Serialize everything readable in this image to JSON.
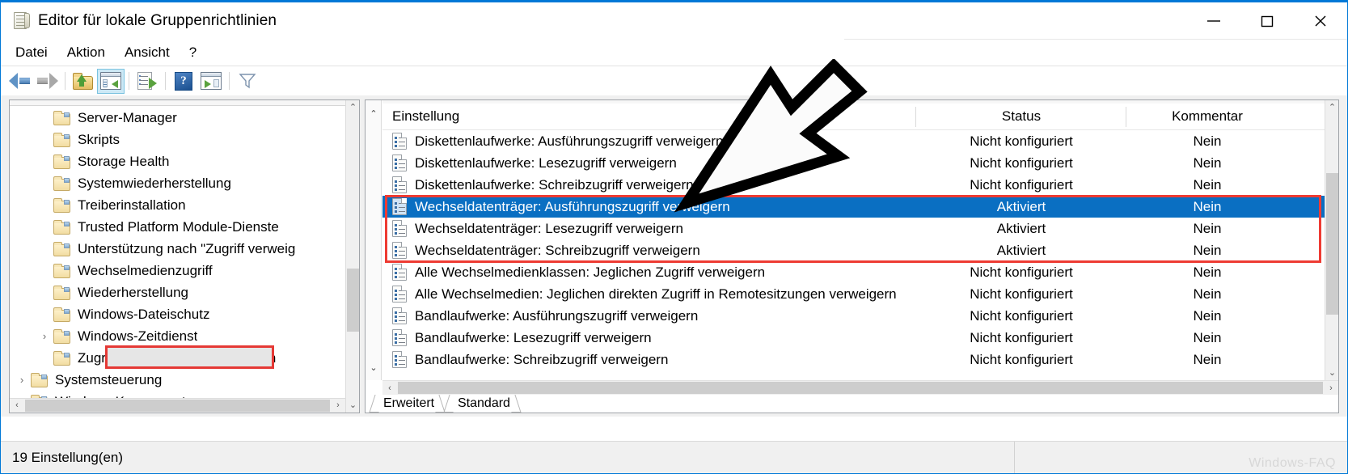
{
  "window": {
    "title": "Editor für lokale Gruppenrichtlinien",
    "icon": "group-policy-document-icon",
    "minimize_label": "—",
    "maximize_label": "□",
    "close_label": "✕"
  },
  "menu": {
    "items": [
      {
        "label": "Datei"
      },
      {
        "label": "Aktion"
      },
      {
        "label": "Ansicht"
      },
      {
        "label": "?"
      }
    ]
  },
  "toolbar": {
    "buttons": [
      {
        "name": "back-icon",
        "label": "Zurück"
      },
      {
        "name": "forward-icon",
        "label": "Vorwärts"
      },
      {
        "name": "up-one-level-icon",
        "label": "Eine Ebene höher"
      },
      {
        "name": "show-hide-console-tree-icon",
        "label": "Konsolenstruktur ein-/ausblenden"
      },
      {
        "name": "export-list-icon",
        "label": "Liste exportieren"
      },
      {
        "name": "help-icon",
        "label": "Hilfe"
      },
      {
        "name": "show-action-pane-icon",
        "label": "Aktionsbereich anzeigen"
      },
      {
        "name": "filter-icon",
        "label": "Filter"
      }
    ]
  },
  "tree": {
    "nodes": [
      {
        "label": "Server-Manager",
        "indent": 2,
        "expandable": false
      },
      {
        "label": "Skripts",
        "indent": 2,
        "expandable": false
      },
      {
        "label": "Storage Health",
        "indent": 2,
        "expandable": false
      },
      {
        "label": "Systemwiederherstellung",
        "indent": 2,
        "expandable": false
      },
      {
        "label": "Treiberinstallation",
        "indent": 2,
        "expandable": false
      },
      {
        "label": "Trusted Platform Module-Dienste",
        "indent": 2,
        "expandable": false
      },
      {
        "label": "Unterstützung nach \"Zugriff verweig",
        "indent": 2,
        "expandable": false
      },
      {
        "label": "Wechselmedienzugriff",
        "indent": 2,
        "expandable": false,
        "selected": true,
        "highlighted": true
      },
      {
        "label": "Wiederherstellung",
        "indent": 2,
        "expandable": false
      },
      {
        "label": "Windows-Dateischutz",
        "indent": 2,
        "expandable": false
      },
      {
        "label": "Windows-Zeitdienst",
        "indent": 2,
        "expandable": true
      },
      {
        "label": "Zugriff auf erweitertes Speichern",
        "indent": 2,
        "expandable": false
      },
      {
        "label": "Systemsteuerung",
        "indent": 1,
        "expandable": true
      },
      {
        "label": "Windows-Komponenten",
        "indent": 1,
        "expandable": true
      }
    ],
    "chevron_glyph": "›"
  },
  "list": {
    "columns": [
      {
        "key": "setting",
        "label": "Einstellung"
      },
      {
        "key": "status",
        "label": "Status"
      },
      {
        "key": "comment",
        "label": "Kommentar"
      }
    ],
    "rows": [
      {
        "setting": "Diskettenlaufwerke: Ausführungszugriff verweigern",
        "status": "Nicht konfiguriert",
        "comment": "Nein",
        "selected": false
      },
      {
        "setting": "Diskettenlaufwerke: Lesezugriff verweigern",
        "status": "Nicht konfiguriert",
        "comment": "Nein",
        "selected": false
      },
      {
        "setting": "Diskettenlaufwerke: Schreibzugriff verweigern",
        "status": "Nicht konfiguriert",
        "comment": "Nein",
        "selected": false
      },
      {
        "setting": "Wechseldatenträger: Ausführungszugriff verweigern",
        "status": "Aktiviert",
        "comment": "Nein",
        "selected": true
      },
      {
        "setting": "Wechseldatenträger: Lesezugriff verweigern",
        "status": "Aktiviert",
        "comment": "Nein",
        "selected": false
      },
      {
        "setting": "Wechseldatenträger: Schreibzugriff verweigern",
        "status": "Aktiviert",
        "comment": "Nein",
        "selected": false
      },
      {
        "setting": "Alle Wechselmedienklassen: Jeglichen Zugriff verweigern",
        "status": "Nicht konfiguriert",
        "comment": "Nein",
        "selected": false
      },
      {
        "setting": "Alle Wechselmedien: Jeglichen direkten Zugriff in Remotesitzungen verweigern",
        "status": "Nicht konfiguriert",
        "comment": "Nein",
        "selected": false
      },
      {
        "setting": "Bandlaufwerke: Ausführungszugriff verweigern",
        "status": "Nicht konfiguriert",
        "comment": "Nein",
        "selected": false
      },
      {
        "setting": "Bandlaufwerke: Lesezugriff verweigern",
        "status": "Nicht konfiguriert",
        "comment": "Nein",
        "selected": false
      },
      {
        "setting": "Bandlaufwerke: Schreibzugriff verweigern",
        "status": "Nicht konfiguriert",
        "comment": "Nein",
        "selected": false
      }
    ]
  },
  "tabs": [
    {
      "label": "Erweitert",
      "active": true
    },
    {
      "label": "Standard",
      "active": false
    }
  ],
  "statusbar": {
    "text": "19 Einstellung(en)",
    "watermark": "Windows-FAQ"
  },
  "annotations": {
    "arrow": "pointer-arrow-annotation",
    "highlight_color": "#ee3b33",
    "selection_color": "#0a6fc2"
  }
}
